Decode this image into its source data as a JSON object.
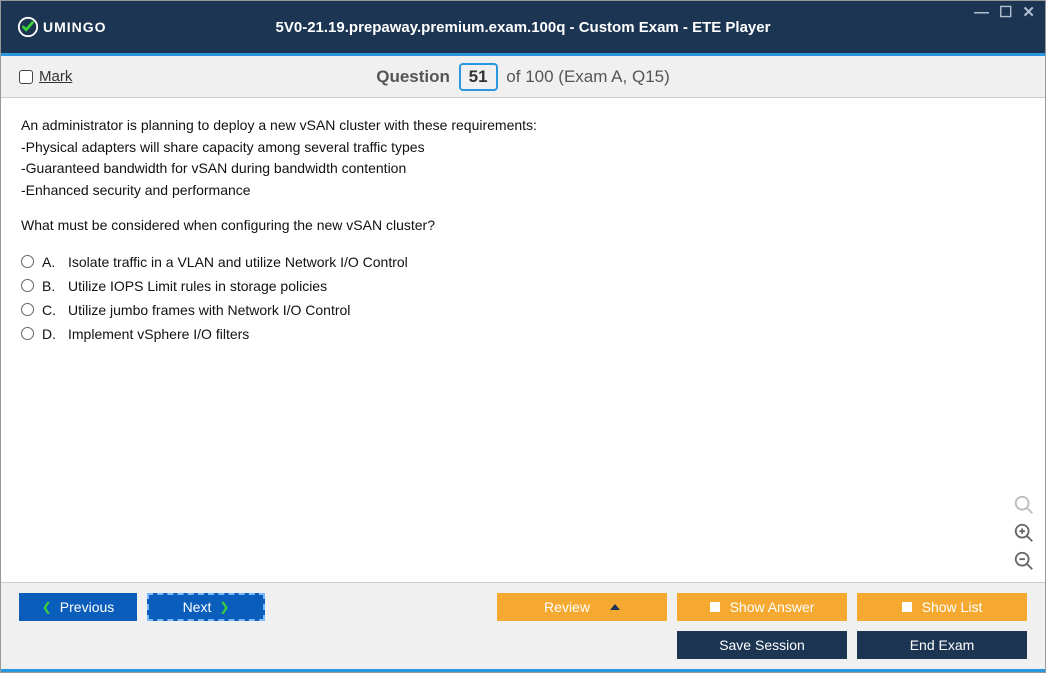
{
  "titlebar": {
    "logo_text": "UMINGO",
    "title": "5V0-21.19.prepaway.premium.exam.100q - Custom Exam - ETE Player"
  },
  "qheader": {
    "mark_label": "Mark",
    "prefix": "Question",
    "current": "51",
    "suffix": "of 100 (Exam A, Q15)"
  },
  "question": {
    "lines": [
      "An administrator is planning to deploy a new vSAN cluster with these requirements:",
      "-Physical adapters will share capacity among several traffic types",
      "-Guaranteed bandwidth for vSAN during bandwidth contention",
      "-Enhanced security and performance"
    ],
    "prompt": "What must be considered when configuring the new vSAN cluster?"
  },
  "answers": [
    {
      "letter": "A.",
      "text": "Isolate traffic in a VLAN and utilize Network I/O Control"
    },
    {
      "letter": "B.",
      "text": "Utilize IOPS Limit rules in storage policies"
    },
    {
      "letter": "C.",
      "text": "Utilize jumbo frames with Network I/O Control"
    },
    {
      "letter": "D.",
      "text": "Implement vSphere I/O filters"
    }
  ],
  "footer": {
    "previous": "Previous",
    "next": "Next",
    "review": "Review",
    "show_answer": "Show Answer",
    "show_list": "Show List",
    "save_session": "Save Session",
    "end_exam": "End Exam"
  }
}
